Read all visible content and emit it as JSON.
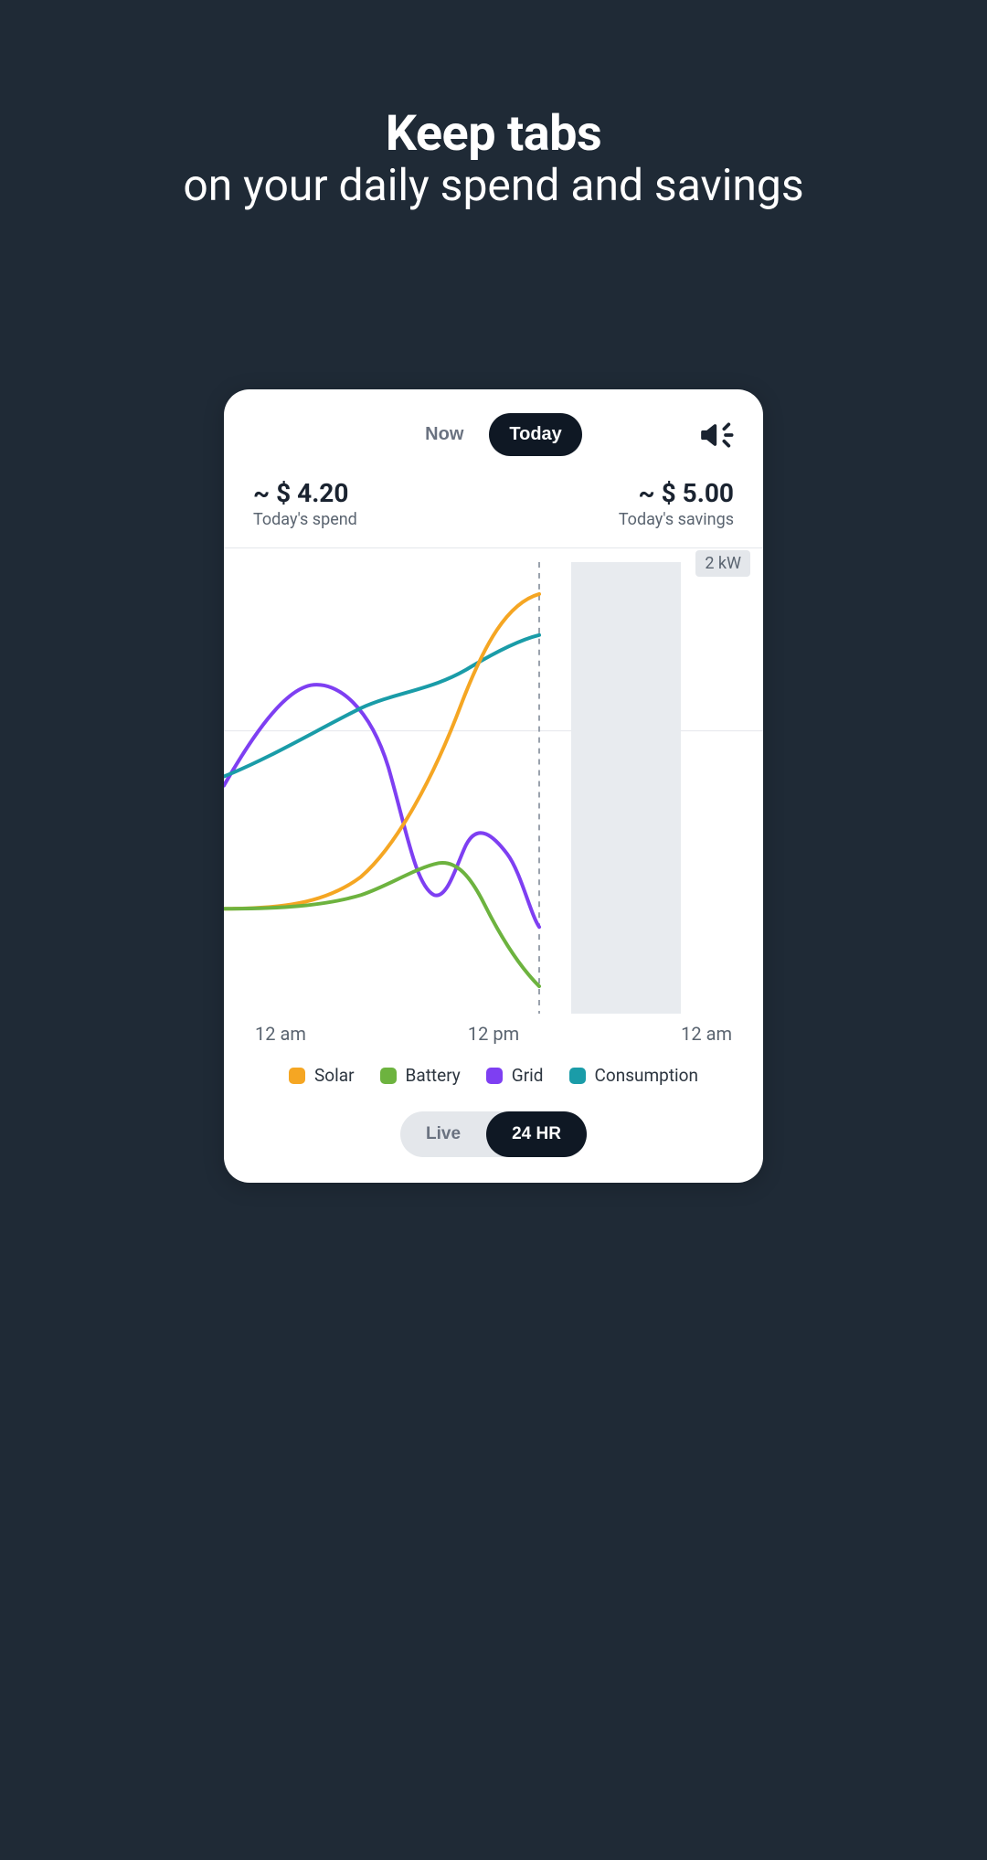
{
  "heading": {
    "bold": "Keep tabs",
    "light": "on your daily spend and savings"
  },
  "tabs": {
    "now": "Now",
    "today": "Today"
  },
  "metrics": {
    "spend_value": "~ $ 4.20",
    "spend_label": "Today's spend",
    "savings_value": "~ $ 5.00",
    "savings_label": "Today's savings"
  },
  "chart": {
    "y_badge": "2 kW",
    "x_left": "12 am",
    "x_mid": "12 pm",
    "x_right": "12 am"
  },
  "legend": {
    "solar": "Solar",
    "battery": "Battery",
    "grid": "Grid",
    "consumption": "Consumption"
  },
  "colors": {
    "solar": "#f5a623",
    "battery": "#6db33f",
    "grid": "#7e3ff2",
    "consumption": "#1a9ca8"
  },
  "bottom": {
    "live": "Live",
    "hr24": "24 HR"
  },
  "chart_data": {
    "type": "line",
    "xlabel": "",
    "ylabel": "",
    "ylim": [
      -0.5,
      2.0
    ],
    "x_hours": [
      0,
      2,
      4,
      6,
      7,
      8,
      9,
      10,
      11,
      12
    ],
    "series": [
      {
        "name": "Solar",
        "values": [
          0.1,
          0.1,
          0.1,
          0.15,
          0.3,
          0.5,
          0.9,
          1.5,
          1.8,
          1.85
        ]
      },
      {
        "name": "Battery",
        "values": [
          0.1,
          0.1,
          0.1,
          0.12,
          0.2,
          0.4,
          0.55,
          0.35,
          0.0,
          -0.4
        ]
      },
      {
        "name": "Grid",
        "values": [
          0.75,
          1.1,
          1.25,
          1.15,
          0.85,
          0.3,
          0.45,
          0.55,
          0.35,
          0.2
        ]
      },
      {
        "name": "Consumption",
        "values": [
          0.85,
          0.9,
          0.95,
          1.05,
          1.1,
          1.15,
          1.25,
          1.4,
          1.55,
          1.6
        ]
      }
    ],
    "current_hour": 12,
    "shaded_region_hours": [
      13,
      17
    ]
  }
}
